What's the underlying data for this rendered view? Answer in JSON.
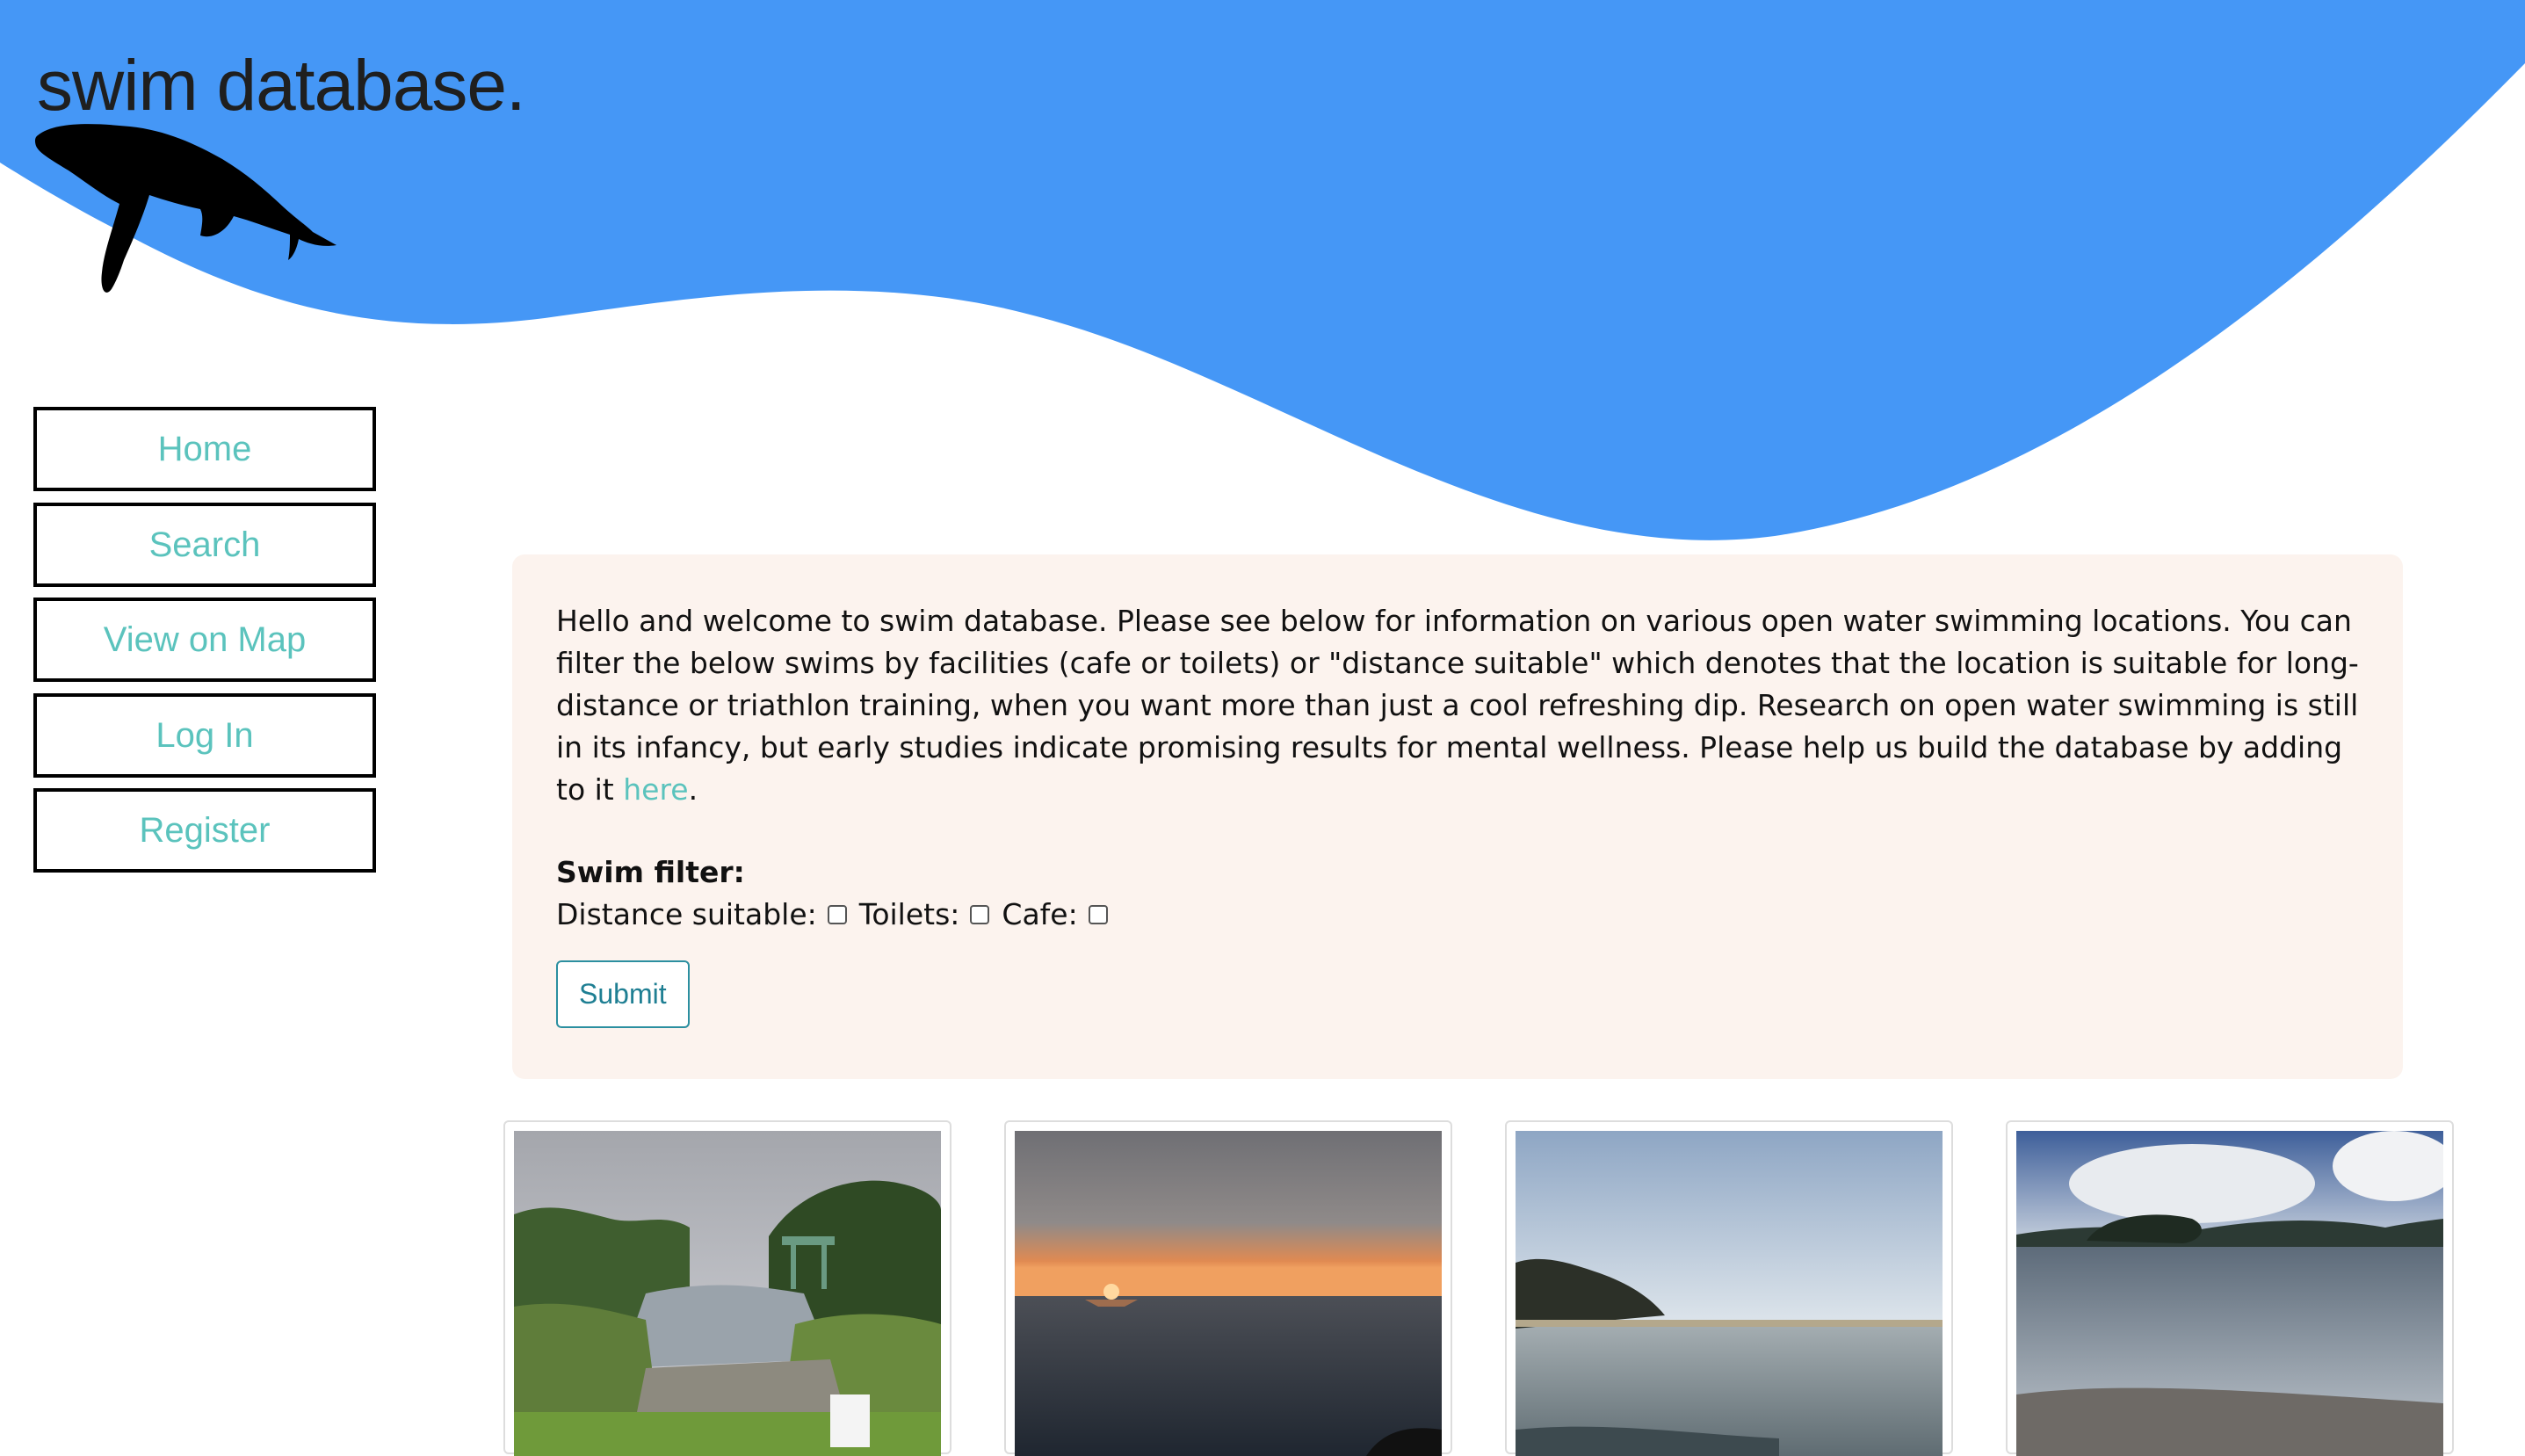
{
  "header": {
    "title": "swim database."
  },
  "nav": {
    "items": [
      {
        "label": "Home"
      },
      {
        "label": "Search"
      },
      {
        "label": "View on Map"
      },
      {
        "label": "Log In"
      },
      {
        "label": "Register"
      }
    ]
  },
  "intro": {
    "text": "Hello and welcome to swim database. Please see below for information on various open water swimming locations. You can filter the below swims by facilities (cafe or toilets) or \"distance suitable\" which denotes that the location is suitable for long-distance or triathlon training, when you want more than just a cool refreshing dip. Research on open water swimming is still in its infancy, but early studies indicate promising results for mental wellness. Please help us build the database by adding to it",
    "link_label": "here",
    "after_link": "."
  },
  "filter": {
    "heading": "Swim filter:",
    "distance_label": "Distance suitable:",
    "toilets_label": "Toilets:",
    "cafe_label": "Cafe:",
    "distance_checked": false,
    "toilets_checked": false,
    "cafe_checked": false,
    "submit_label": "Submit"
  },
  "colors": {
    "wave": "#4597f6",
    "link": "#5bc3bd",
    "panel": "#fcf3ee"
  },
  "cards": [
    {
      "icon": "river-photo"
    },
    {
      "icon": "sunset-sea-photo"
    },
    {
      "icon": "coastline-photo"
    },
    {
      "icon": "lake-photo"
    }
  ]
}
